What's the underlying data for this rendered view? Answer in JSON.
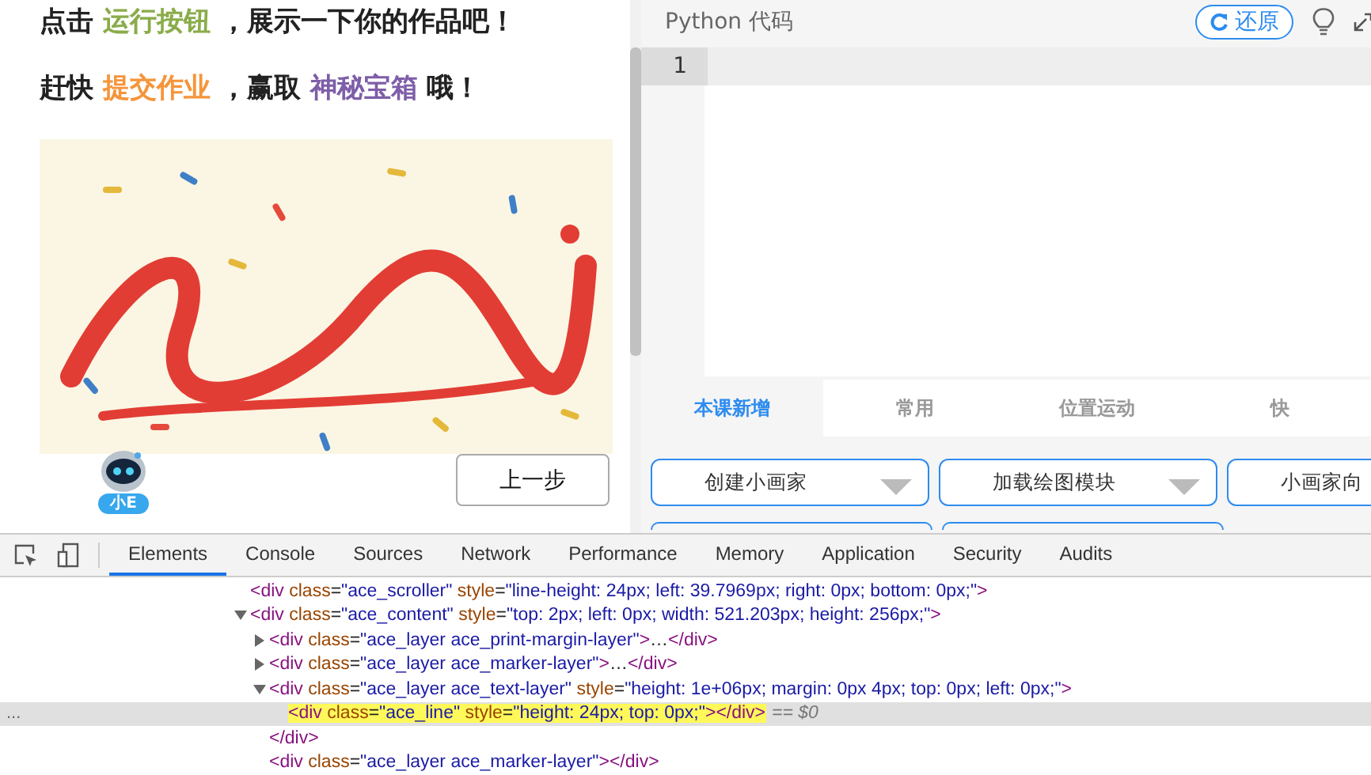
{
  "lesson": {
    "lines": [
      [
        {
          "text": "点击 "
        },
        {
          "text": "运行按钮",
          "color": "#8aac4a"
        },
        {
          "text": " ，展示一下你的作品吧！"
        }
      ],
      [
        {
          "text": "赶快 "
        },
        {
          "text": "提交作业",
          "color": "#f5953b"
        },
        {
          "text": " ，赢取 "
        },
        {
          "text": "神秘宝箱",
          "color": "#7e5ea8"
        },
        {
          "text": " 哦！"
        }
      ]
    ],
    "image": {
      "kind": "picture"
    },
    "mascot_badge": "小E",
    "back_button": "上一步"
  },
  "editor": {
    "title": "Python 代码",
    "reset_button": "还原",
    "line_numbers": [
      "1"
    ]
  },
  "block_tabs": [
    {
      "label": "本课新增",
      "selected": true
    },
    {
      "label": "常用",
      "selected": false
    },
    {
      "label": "位置运动",
      "selected": false
    },
    {
      "label": "快",
      "selected": false
    }
  ],
  "blocks": [
    {
      "label": "创建小画家",
      "dropdown": true
    },
    {
      "label": "加载绘图模块",
      "dropdown": true
    },
    {
      "label": "小画家向"
    }
  ],
  "devtools": {
    "tabs": [
      {
        "label": "Elements",
        "selected": true
      },
      {
        "label": "Console",
        "selected": false
      },
      {
        "label": "Sources",
        "selected": false
      },
      {
        "label": "Network",
        "selected": false
      },
      {
        "label": "Performance",
        "selected": false
      },
      {
        "label": "Memory",
        "selected": false
      },
      {
        "label": "Application",
        "selected": false
      },
      {
        "label": "Security",
        "selected": false
      },
      {
        "label": "Audits",
        "selected": false
      }
    ],
    "tree": [
      {
        "tokens": [
          {
            "kind": "tag",
            "t": "<div"
          },
          {
            "kind": "attr",
            "t": " class"
          },
          {
            "kind": "punct",
            "t": "="
          },
          {
            "kind": "value",
            "t": "\"ace_scroller\""
          },
          {
            "kind": "attr",
            "t": " style"
          },
          {
            "kind": "punct",
            "t": "="
          },
          {
            "kind": "value",
            "t": "\"line-height: 24px; left: 39.7969px; right: 0px; bottom: 0px;\""
          },
          {
            "kind": "tag",
            "t": ">"
          }
        ]
      },
      {
        "expanded": true,
        "tokens": [
          {
            "kind": "tag",
            "t": "<div"
          },
          {
            "kind": "attr",
            "t": " class"
          },
          {
            "kind": "punct",
            "t": "="
          },
          {
            "kind": "value",
            "t": "\"ace_content\""
          },
          {
            "kind": "attr",
            "t": " style"
          },
          {
            "kind": "punct",
            "t": "="
          },
          {
            "kind": "value",
            "t": "\"top: 2px; left: 0px; width: 521.203px; height: 256px;\""
          },
          {
            "kind": "tag",
            "t": ">"
          }
        ],
        "children": [
          {
            "expanded": false,
            "tokens": [
              {
                "kind": "tag",
                "t": "<div"
              },
              {
                "kind": "attr",
                "t": " class"
              },
              {
                "kind": "punct",
                "t": "="
              },
              {
                "kind": "value",
                "t": "\"ace_layer ace_print-margin-layer\""
              },
              {
                "kind": "tag",
                "t": ">"
              },
              {
                "kind": "punct",
                "t": "…"
              },
              {
                "kind": "tag",
                "t": "</div>"
              }
            ]
          },
          {
            "expanded": false,
            "tokens": [
              {
                "kind": "tag",
                "t": "<div"
              },
              {
                "kind": "attr",
                "t": " class"
              },
              {
                "kind": "punct",
                "t": "="
              },
              {
                "kind": "value",
                "t": "\"ace_layer ace_marker-layer\""
              },
              {
                "kind": "tag",
                "t": ">"
              },
              {
                "kind": "punct",
                "t": "…"
              },
              {
                "kind": "tag",
                "t": "</div>"
              }
            ]
          },
          {
            "expanded": true,
            "tokens": [
              {
                "kind": "tag",
                "t": "<div"
              },
              {
                "kind": "attr",
                "t": " class"
              },
              {
                "kind": "punct",
                "t": "="
              },
              {
                "kind": "value",
                "t": "\"ace_layer ace_text-layer\""
              },
              {
                "kind": "attr",
                "t": " style"
              },
              {
                "kind": "punct",
                "t": "="
              },
              {
                "kind": "value",
                "t": "\"height: 1e+06px; margin: 0px 4px; top: 0px; left: 0px;\""
              },
              {
                "kind": "tag",
                "t": ">"
              }
            ],
            "children": [
              {
                "selected": true,
                "marker": "== $0",
                "tokens": [
                  {
                    "kind": "tag",
                    "t": "<div"
                  },
                  {
                    "kind": "attr",
                    "t": " class"
                  },
                  {
                    "kind": "punct",
                    "t": "="
                  },
                  {
                    "kind": "value",
                    "t": "\"ace_line\""
                  },
                  {
                    "kind": "attr",
                    "t": " style"
                  },
                  {
                    "kind": "punct",
                    "t": "="
                  },
                  {
                    "kind": "value",
                    "t": "\"height: 24px; top: 0px;\""
                  },
                  {
                    "kind": "tag",
                    "t": ">"
                  },
                  {
                    "kind": "tag",
                    "t": "</div>"
                  }
                ]
              }
            ],
            "closing": "</div>"
          },
          {
            "tokens": [
              {
                "kind": "tag",
                "t": "<div"
              },
              {
                "kind": "attr",
                "t": " class"
              },
              {
                "kind": "punct",
                "t": "="
              },
              {
                "kind": "value",
                "t": "\"ace_layer ace_marker-layer\""
              },
              {
                "kind": "tag",
                "t": ">"
              },
              {
                "kind": "tag",
                "t": "</div>"
              }
            ]
          }
        ]
      }
    ],
    "selected_row_gutter": "..."
  }
}
